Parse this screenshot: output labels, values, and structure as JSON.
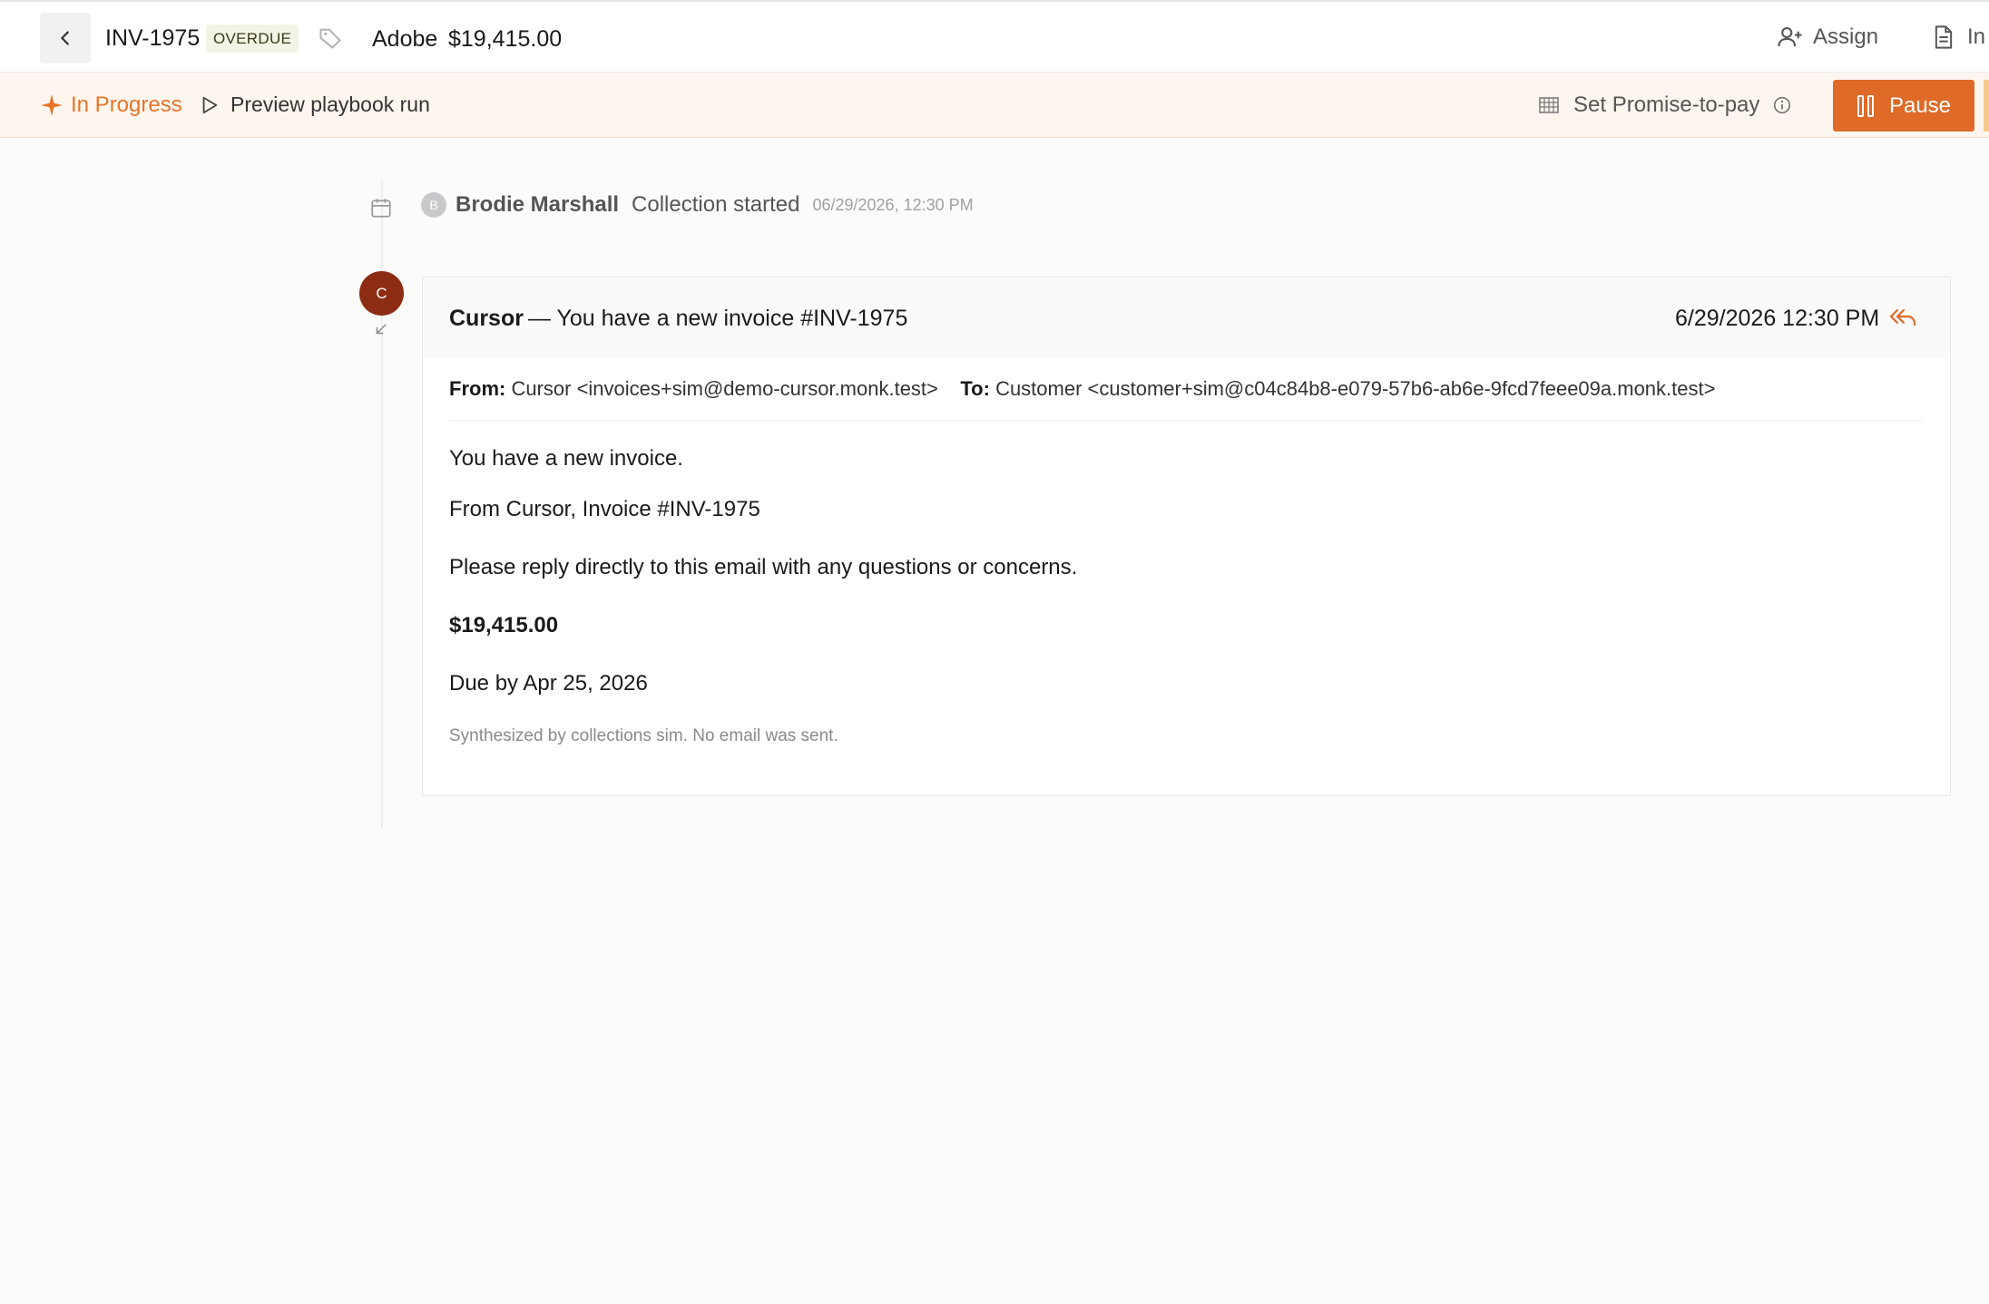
{
  "header": {
    "invoice_id": "INV-1975",
    "status_badge": "OVERDUE",
    "customer": "Adobe",
    "amount": "$19,415.00",
    "assign_label": "Assign",
    "invoice_label": "In"
  },
  "status_bar": {
    "state_label": "In Progress",
    "preview_label": "Preview playbook run",
    "promise_label": "Set Promise-to-pay",
    "pause_label": "Pause"
  },
  "timeline": {
    "events": [
      {
        "avatar_initial": "B",
        "actor": "Brodie Marshall",
        "text": "Collection started",
        "time": "06/29/2026, 12:30 PM"
      }
    ],
    "email": {
      "avatar_initial": "C",
      "sender": "Cursor",
      "subject": "— You have a new invoice #INV-1975",
      "date": "6/29/2026 12:30 PM",
      "from_label": "From:",
      "from_value": "Cursor <invoices+sim@demo-cursor.monk.test>",
      "to_label": "To:",
      "to_value": "Customer <customer+sim@c04c84b8-e079-57b6-ab6e-9fcd7feee09a.monk.test>",
      "body": {
        "line1": "You have a new invoice.",
        "line2": "From Cursor, Invoice #INV-1975",
        "line3": "Please reply directly to this email with any questions or concerns.",
        "amount": "$19,415.00",
        "due": "Due by Apr 25, 2026"
      },
      "footnote": "Synthesized by collections sim. No email was sent."
    }
  },
  "colors": {
    "accent_orange": "#e06a28",
    "in_progress": "#e8742a",
    "avatar_c": "#8c2c12",
    "status_bar_bg": "#fdf6ee"
  },
  "icons": [
    "chevron-left-icon",
    "tag-icon",
    "user-plus-icon",
    "document-icon",
    "sparkle-icon",
    "play-icon",
    "calendar-grid-icon",
    "info-icon",
    "pause-icon",
    "calendar-icon",
    "collapse-arrow-icon",
    "reply-all-icon"
  ]
}
